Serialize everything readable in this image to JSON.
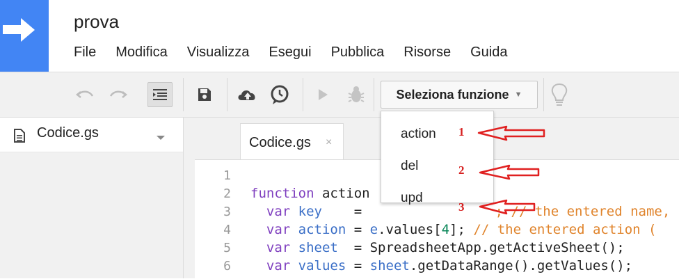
{
  "app": {
    "title": "prova",
    "menu": [
      "File",
      "Modifica",
      "Visualizza",
      "Esegui",
      "Pubblica",
      "Risorse",
      "Guida"
    ]
  },
  "toolbar": {
    "function_select_label": "Seleziona funzione",
    "icons": [
      "undo-icon",
      "redo-icon",
      "indent-icon",
      "save-icon",
      "cloud-upload-icon",
      "clock-trigger-icon",
      "run-icon",
      "debug-bug-icon",
      "lightbulb-icon"
    ]
  },
  "sidebar": {
    "file_name": "Codice.gs"
  },
  "editor": {
    "tab_label": "Codice.gs",
    "tab_close": "×",
    "line_numbers": [
      "1",
      "2",
      "3",
      "4",
      "5",
      "6"
    ],
    "lines": {
      "l2_kw": "function",
      "l2_rest": " action",
      "l3_kw": "var",
      "l3_var": " key",
      "l3_rest": "    = ",
      "l3_tail": "; // the entered name, co",
      "l4_kw": "var",
      "l4_var": " action",
      "l4_rest": " = ",
      "l4_e": "e",
      "l4_vals": ".values[",
      "l4_num": "4",
      "l4_close": "]; ",
      "l4_cm": "// the entered action (",
      "l5_kw": "var",
      "l5_var": " sheet",
      "l5_rest": "  = SpreadsheetApp.getActiveSheet();",
      "l6_kw": "var",
      "l6_var": " values",
      "l6_rest": " = ",
      "l6_sheet": "sheet",
      "l6_tail": ".getDataRange().getValues();"
    }
  },
  "dropdown": {
    "items": [
      "action",
      "del",
      "upd"
    ]
  },
  "annotations": {
    "numbers": [
      "1",
      "2",
      "3"
    ],
    "arrow_color": "#e02020"
  },
  "colors": {
    "brand_blue": "#4285f4",
    "keyword": "#7f3fbf",
    "variable": "#3b6fc7",
    "comment": "#e0842c",
    "annotation_red": "#d61f1f"
  }
}
